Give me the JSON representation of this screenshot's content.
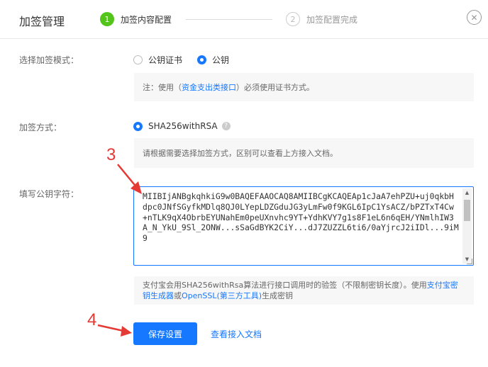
{
  "header": {
    "title": "加签管理",
    "steps": [
      {
        "num": "1",
        "label": "加签内容配置"
      },
      {
        "num": "2",
        "label": "加签配置完成"
      }
    ],
    "close_symbol": "✕"
  },
  "sign_mode": {
    "label": "选择加签模式：",
    "options": [
      "公钥证书",
      "公钥"
    ],
    "selected": "公钥",
    "note_prefix": "注：使用（",
    "note_link": "资金支出类接口",
    "note_suffix": "）必须使用证书方式。"
  },
  "sign_method": {
    "label": "加签方式：",
    "option": "SHA256withRSA",
    "help_symbol": "?",
    "note": "请根据需要选择加签方式，区别可以查看上方接入文档。"
  },
  "public_key": {
    "label": "填写公钥字符：",
    "value": "MIIBIjANBgkqhkiG9w0BAQEFAAOCAQ8AMIIBCgKCAQEAp1cJaA7ehPZU+uj0qkbH\ndpc0JNfSGyfkMDlq8QJ0LYepLDZGduJG3yLmFw0f9KGL6IpC1YsACZ/bPZTxT4Cw\n+nTLK9qX4ObrbEYUNahEm0peUXnvhc9YT+YdhKVY7g1s8F1eL6n6qEH/YNmlhIW3\nA_N_YkU_9Sl_2ONW...sSaGdBYK2CiY...dJ7ZUZZL6ti6/0aYjrcJ2iIDl...9iM9",
    "note_prefix": "支付宝会用SHA256withRsa算法进行接口调用时的验签（不限制密钥长度）。使用",
    "link1": "支付宝密钥生成器",
    "note_mid": "或",
    "link2": "OpenSSL(第三方工具)",
    "note_suffix": "生成密钥"
  },
  "actions": {
    "save": "保存设置",
    "view_docs": "查看接入文档"
  },
  "annotations": {
    "three": "3",
    "four": "4",
    "color": "#e53935"
  },
  "colors": {
    "primary": "#1677ff",
    "step_active": "#52c41a"
  }
}
